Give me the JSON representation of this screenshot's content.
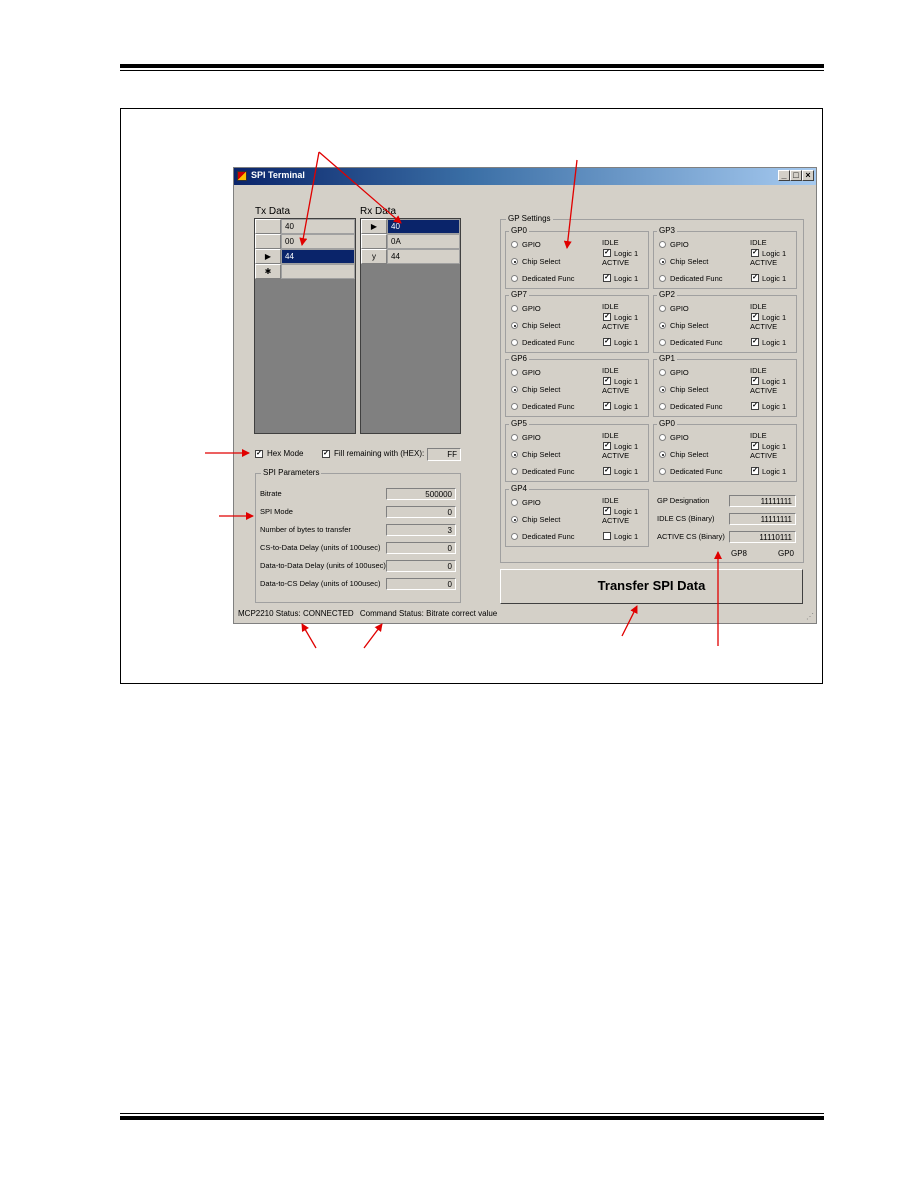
{
  "window": {
    "title": "SPI Terminal",
    "minimize": "_",
    "maximize": "□",
    "close": "×"
  },
  "tx": {
    "label": "Tx Data",
    "rows": [
      {
        "marker": "",
        "value": "40"
      },
      {
        "marker": "",
        "value": "00"
      },
      {
        "marker": "▶",
        "value": "44"
      },
      {
        "marker": "✱",
        "value": ""
      }
    ]
  },
  "rx": {
    "label": "Rx Data",
    "rows": [
      {
        "marker": "▶",
        "value": "40"
      },
      {
        "marker": "",
        "value": "0A"
      },
      {
        "marker": "y",
        "value": "44"
      }
    ]
  },
  "options": {
    "hex_mode": "Hex Mode",
    "fill_remaining": "Fill remaining with (HEX):",
    "fill_value": "FF"
  },
  "spi_params": {
    "title": "SPI Parameters",
    "items": [
      {
        "label": "Bitrate",
        "value": "500000"
      },
      {
        "label": "SPI Mode",
        "value": "0"
      },
      {
        "label": "Number of bytes to transfer",
        "value": "3"
      },
      {
        "label": "CS-to-Data Delay (units of 100usec)",
        "value": "0"
      },
      {
        "label": "Data-to-Data Delay (units of 100usec)",
        "value": "0"
      },
      {
        "label": "Data-to-CS Delay (units of 100usec)",
        "value": "0"
      }
    ]
  },
  "gp_settings": {
    "title": "GP Settings",
    "groups": [
      {
        "name": "GP0",
        "selected": 1,
        "idle_checked": true,
        "active_checked": true
      },
      {
        "name": "GP3",
        "selected": 1,
        "idle_checked": true,
        "active_checked": true
      },
      {
        "name": "GP7",
        "selected": 1,
        "idle_checked": true,
        "active_checked": true
      },
      {
        "name": "GP2",
        "selected": 1,
        "idle_checked": true,
        "active_checked": true
      },
      {
        "name": "GP6",
        "selected": 1,
        "idle_checked": true,
        "active_checked": true
      },
      {
        "name": "GP1",
        "selected": 1,
        "idle_checked": true,
        "active_checked": true
      },
      {
        "name": "GP5",
        "selected": 1,
        "idle_checked": true,
        "active_checked": true
      },
      {
        "name": "GP0",
        "selected": 1,
        "idle_checked": true,
        "active_checked": true
      },
      {
        "name": "GP4",
        "selected": 1,
        "idle_checked": true,
        "active_checked": false
      }
    ],
    "labels": {
      "gpio": "GPIO",
      "chip_select": "Chip Select",
      "dedicated": "Dedicated Func",
      "idle": "IDLE",
      "active": "ACTIVE",
      "logic1": "Logic 1"
    },
    "summary": [
      {
        "label": "GP Designation",
        "value": "11111111"
      },
      {
        "label": "IDLE CS (Binary)",
        "value": "11111111"
      },
      {
        "label": "ACTIVE CS (Binary)",
        "value": "11110111"
      }
    ],
    "bit_left": "GP8",
    "bit_right": "GP0"
  },
  "transfer_button": "Transfer SPI Data",
  "status": {
    "device_label": "MCP2210 Status:",
    "device_value": "CONNECTED",
    "command_label": "Command Status:",
    "command_value": "Bitrate correct value"
  },
  "colors": {
    "arrow": "#e00000",
    "selection": "#0a246a",
    "window_bg": "#d4d0c8"
  }
}
